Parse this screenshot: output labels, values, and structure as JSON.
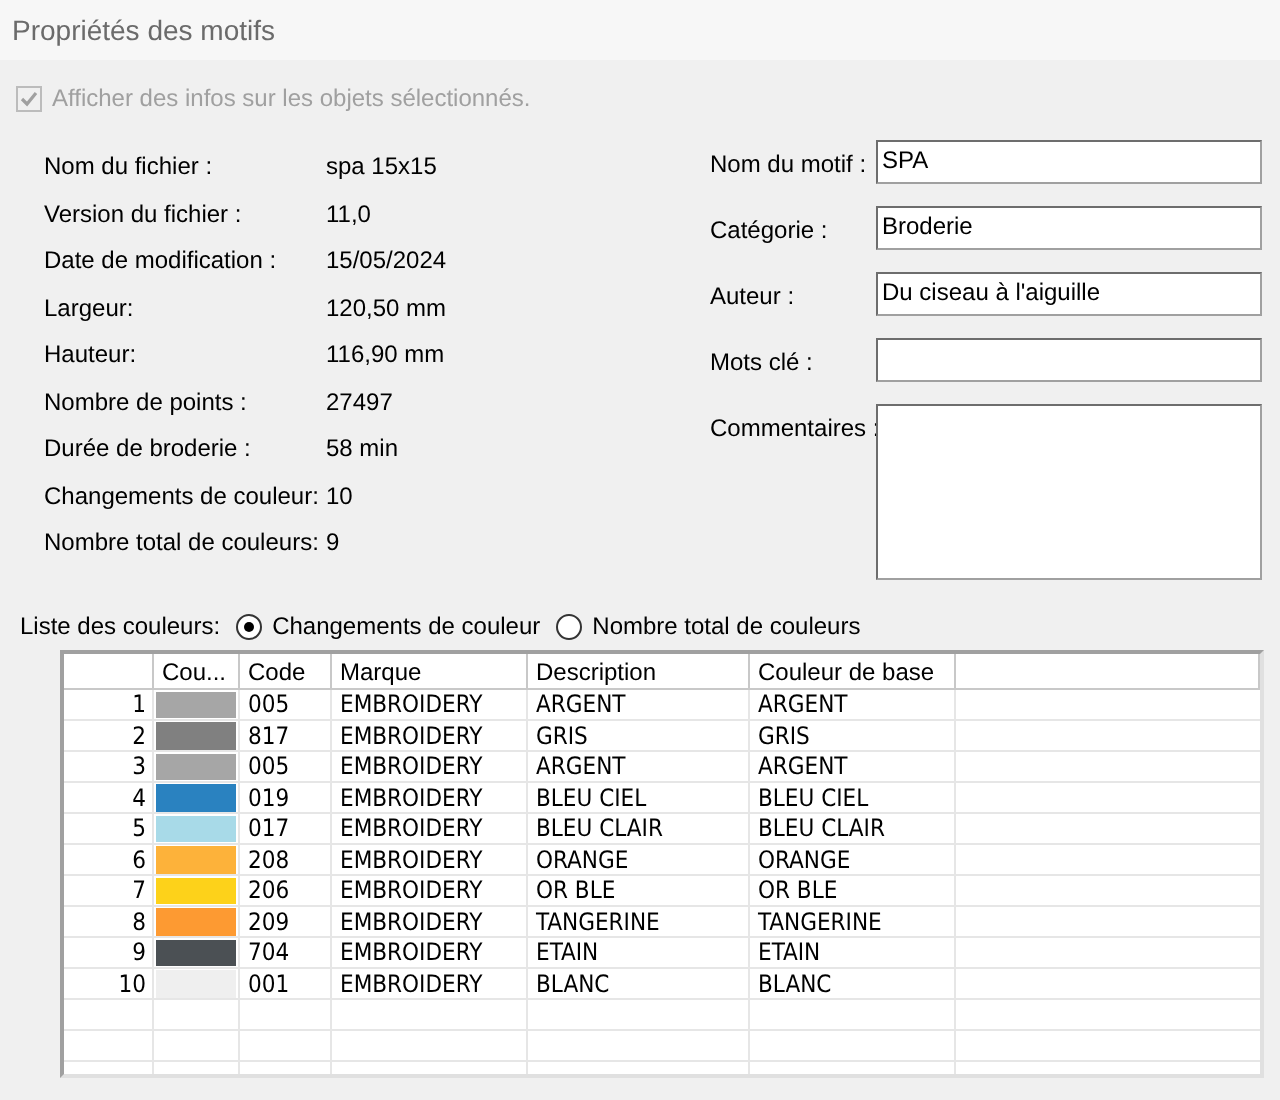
{
  "window": {
    "title": "Propriétés des motifs"
  },
  "show_info": {
    "label": "Afficher des infos sur les objets sélectionnés.",
    "checked": true,
    "disabled": true
  },
  "info": [
    {
      "label": "Nom du fichier :",
      "value": "spa 15x15"
    },
    {
      "label": "Version du fichier :",
      "value": "11,0"
    },
    {
      "label": "Date de modification :",
      "value": "15/05/2024"
    },
    {
      "label": "Largeur:",
      "value": "120,50 mm"
    },
    {
      "label": "Hauteur:",
      "value": "116,90 mm"
    },
    {
      "label": "Nombre de points :",
      "value": "27497"
    },
    {
      "label": "Durée de broderie :",
      "value": "58 min"
    },
    {
      "label": "Changements de couleur:",
      "value": "10"
    },
    {
      "label": "Nombre total de couleurs:",
      "value": "9"
    }
  ],
  "fields": [
    {
      "label": "Nom du motif :",
      "value": "SPA",
      "kind": "line"
    },
    {
      "label": "Catégorie :",
      "value": "Broderie",
      "kind": "line"
    },
    {
      "label": "Auteur :",
      "value": "Du ciseau à l'aiguille",
      "kind": "line"
    },
    {
      "label": "Mots clé :",
      "kind": "line"
    },
    {
      "label": "Commentaires :",
      "kind": "area"
    }
  ],
  "color_list": {
    "label": "Liste des couleurs:",
    "options": [
      {
        "label": "Changements de couleur",
        "selected": true
      },
      {
        "label": "Nombre total de couleurs",
        "selected": false
      }
    ]
  },
  "table": {
    "columns": [
      "Cou...",
      "Code",
      "Marque",
      "Description",
      "Couleur de base"
    ],
    "rows": [
      {
        "index": "1",
        "color": "#a6a6a6",
        "code": "005",
        "brand": "EMBROIDERY",
        "description": "ARGENT",
        "base": "ARGENT"
      },
      {
        "index": "2",
        "color": "#808080",
        "code": "817",
        "brand": "EMBROIDERY",
        "description": "GRIS",
        "base": "GRIS"
      },
      {
        "index": "3",
        "color": "#a6a6a6",
        "code": "005",
        "brand": "EMBROIDERY",
        "description": "ARGENT",
        "base": "ARGENT"
      },
      {
        "index": "4",
        "color": "#2a82c0",
        "code": "019",
        "brand": "EMBROIDERY",
        "description": "BLEU CIEL",
        "base": "BLEU CIEL"
      },
      {
        "index": "5",
        "color": "#a8dae8",
        "code": "017",
        "brand": "EMBROIDERY",
        "description": "BLEU CLAIR",
        "base": "BLEU CLAIR"
      },
      {
        "index": "6",
        "color": "#fdb23a",
        "code": "208",
        "brand": "EMBROIDERY",
        "description": "ORANGE",
        "base": "ORANGE"
      },
      {
        "index": "7",
        "color": "#fdd21a",
        "code": "206",
        "brand": "EMBROIDERY",
        "description": "OR BLE",
        "base": "OR BLE"
      },
      {
        "index": "8",
        "color": "#fd9a32",
        "code": "209",
        "brand": "EMBROIDERY",
        "description": "TANGERINE",
        "base": "TANGERINE"
      },
      {
        "index": "9",
        "color": "#4b5054",
        "code": "704",
        "brand": "EMBROIDERY",
        "description": "ETAIN",
        "base": "ETAIN"
      },
      {
        "index": "10",
        "color": "#efefef",
        "code": "001",
        "brand": "EMBROIDERY",
        "description": "BLANC",
        "base": "BLANC"
      }
    ]
  }
}
